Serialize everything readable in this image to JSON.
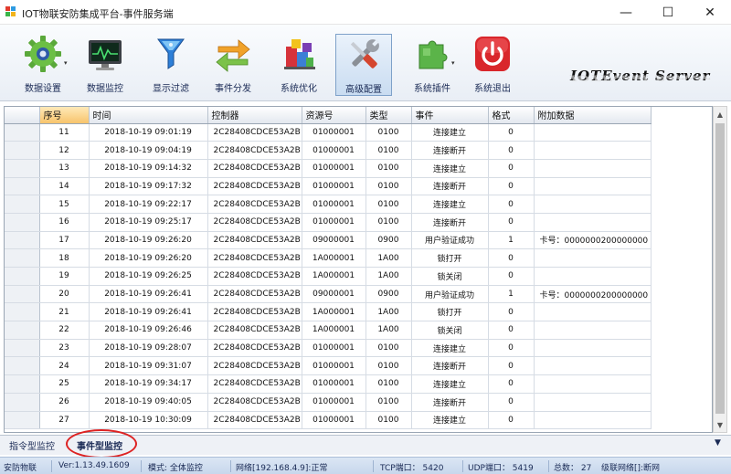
{
  "window": {
    "title": "IOT物联安防集成平台-事件服务端",
    "minimize_icon": "—",
    "maximize_icon": "☐",
    "close_icon": "✕"
  },
  "toolbar": {
    "items": [
      {
        "label": "数据设置",
        "icon": "gear-icon"
      },
      {
        "label": "数据监控",
        "icon": "monitor-icon"
      },
      {
        "label": "显示过滤",
        "icon": "filter-icon"
      },
      {
        "label": "事件分发",
        "icon": "exchange-arrows-icon"
      },
      {
        "label": "系统优化",
        "icon": "optimize-blocks-icon"
      },
      {
        "label": "高级配置",
        "icon": "tools-icon"
      },
      {
        "label": "系统插件",
        "icon": "puzzle-icon"
      },
      {
        "label": "系统退出",
        "icon": "power-icon"
      }
    ],
    "dropdown_glyph": "▾"
  },
  "brand": {
    "text": "IOTEvent Server"
  },
  "table": {
    "columns": [
      "序号",
      "时间",
      "控制器",
      "资源号",
      "类型",
      "事件",
      "格式",
      "附加数据"
    ],
    "rows": [
      [
        "11",
        "2018-10-19 09:01:19",
        "2C28408CDCE53A2B",
        "01000001",
        "0100",
        "连接建立",
        "0",
        ""
      ],
      [
        "12",
        "2018-10-19 09:04:19",
        "2C28408CDCE53A2B",
        "01000001",
        "0100",
        "连接断开",
        "0",
        ""
      ],
      [
        "13",
        "2018-10-19 09:14:32",
        "2C28408CDCE53A2B",
        "01000001",
        "0100",
        "连接建立",
        "0",
        ""
      ],
      [
        "14",
        "2018-10-19 09:17:32",
        "2C28408CDCE53A2B",
        "01000001",
        "0100",
        "连接断开",
        "0",
        ""
      ],
      [
        "15",
        "2018-10-19 09:22:17",
        "2C28408CDCE53A2B",
        "01000001",
        "0100",
        "连接建立",
        "0",
        ""
      ],
      [
        "16",
        "2018-10-19 09:25:17",
        "2C28408CDCE53A2B",
        "01000001",
        "0100",
        "连接断开",
        "0",
        ""
      ],
      [
        "17",
        "2018-10-19 09:26:20",
        "2C28408CDCE53A2B",
        "09000001",
        "0900",
        "用户验证成功",
        "1",
        "卡号：0000000200000000"
      ],
      [
        "18",
        "2018-10-19 09:26:20",
        "2C28408CDCE53A2B",
        "1A000001",
        "1A00",
        "锁打开",
        "0",
        ""
      ],
      [
        "19",
        "2018-10-19 09:26:25",
        "2C28408CDCE53A2B",
        "1A000001",
        "1A00",
        "锁关闭",
        "0",
        ""
      ],
      [
        "20",
        "2018-10-19 09:26:41",
        "2C28408CDCE53A2B",
        "09000001",
        "0900",
        "用户验证成功",
        "1",
        "卡号：0000000200000000"
      ],
      [
        "21",
        "2018-10-19 09:26:41",
        "2C28408CDCE53A2B",
        "1A000001",
        "1A00",
        "锁打开",
        "0",
        ""
      ],
      [
        "22",
        "2018-10-19 09:26:46",
        "2C28408CDCE53A2B",
        "1A000001",
        "1A00",
        "锁关闭",
        "0",
        ""
      ],
      [
        "23",
        "2018-10-19 09:28:07",
        "2C28408CDCE53A2B",
        "01000001",
        "0100",
        "连接建立",
        "0",
        ""
      ],
      [
        "24",
        "2018-10-19 09:31:07",
        "2C28408CDCE53A2B",
        "01000001",
        "0100",
        "连接断开",
        "0",
        ""
      ],
      [
        "25",
        "2018-10-19 09:34:17",
        "2C28408CDCE53A2B",
        "01000001",
        "0100",
        "连接建立",
        "0",
        ""
      ],
      [
        "26",
        "2018-10-19 09:40:05",
        "2C28408CDCE53A2B",
        "01000001",
        "0100",
        "连接断开",
        "0",
        ""
      ],
      [
        "27",
        "2018-10-19 10:30:09",
        "2C28408CDCE53A2B",
        "01000001",
        "0100",
        "连接建立",
        "0",
        ""
      ]
    ]
  },
  "tabs": {
    "items": [
      "指令型监控",
      "事件型监控"
    ],
    "active": "事件型监控",
    "arrow": "▼"
  },
  "status": {
    "app": "安防物联",
    "version": "Ver:1.13.49.1609",
    "mode": "模式: 全体监控",
    "network": "网络[192.168.4.9]:正常",
    "tcp": "TCP端口：  5420",
    "udp": "UDP端口：  5419",
    "total": "总数：  27",
    "cascade": "级联网络[]:断网"
  },
  "colors": {
    "accent": "#1a2a55",
    "highlight_oval": "#dd2222",
    "header_selected": "#f7c46c"
  }
}
